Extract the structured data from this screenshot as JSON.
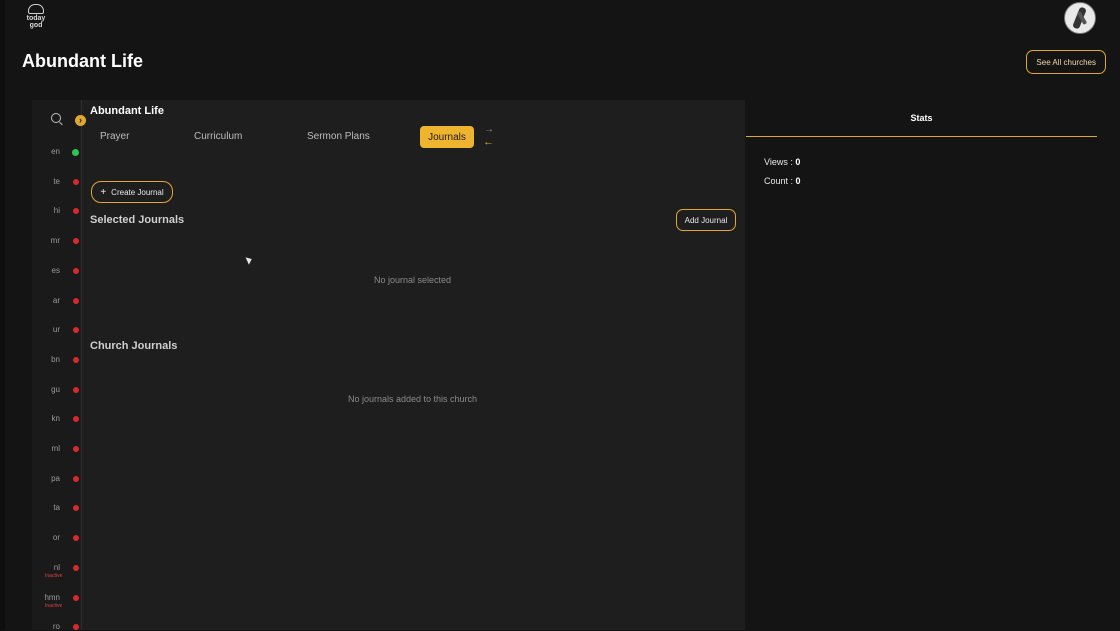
{
  "logo": {
    "text": "today god"
  },
  "page": {
    "title": "Abundant Life",
    "see_all": "See All churches"
  },
  "church": {
    "name": "Abundant Life"
  },
  "tabs": [
    {
      "label": "Prayer"
    },
    {
      "label": "Curriculum"
    },
    {
      "label": "Sermon Plans"
    },
    {
      "label": "Journals",
      "active": true
    }
  ],
  "languages": [
    {
      "code": "en",
      "status": "active"
    },
    {
      "code": "te",
      "status": "missing"
    },
    {
      "code": "hi",
      "status": "missing"
    },
    {
      "code": "mr",
      "status": "missing"
    },
    {
      "code": "es",
      "status": "missing"
    },
    {
      "code": "ar",
      "status": "missing"
    },
    {
      "code": "ur",
      "status": "missing"
    },
    {
      "code": "bn",
      "status": "missing"
    },
    {
      "code": "gu",
      "status": "missing"
    },
    {
      "code": "kn",
      "status": "missing"
    },
    {
      "code": "ml",
      "status": "missing"
    },
    {
      "code": "pa",
      "status": "missing"
    },
    {
      "code": "ta",
      "status": "missing"
    },
    {
      "code": "or",
      "status": "missing"
    },
    {
      "code": "nl",
      "status": "missing",
      "note": "Inactive"
    },
    {
      "code": "hmn",
      "status": "missing",
      "note": "Inactive"
    },
    {
      "code": "ro",
      "status": "missing"
    }
  ],
  "actions": {
    "create_journal": "Create Journal",
    "add_journal": "Add Journal"
  },
  "selected": {
    "title": "Selected Journals",
    "empty": "No journal selected"
  },
  "church_journals": {
    "title": "Church Journals",
    "empty": "No journals added to this church"
  },
  "stats": {
    "tab": "Stats",
    "views_label": "Views :",
    "views": "0",
    "count_label": "Count :",
    "count": "0"
  },
  "colors": {
    "accent": "#e0a82e",
    "ok": "#2fc64f",
    "error": "#d72a2a",
    "background": "#141414"
  }
}
